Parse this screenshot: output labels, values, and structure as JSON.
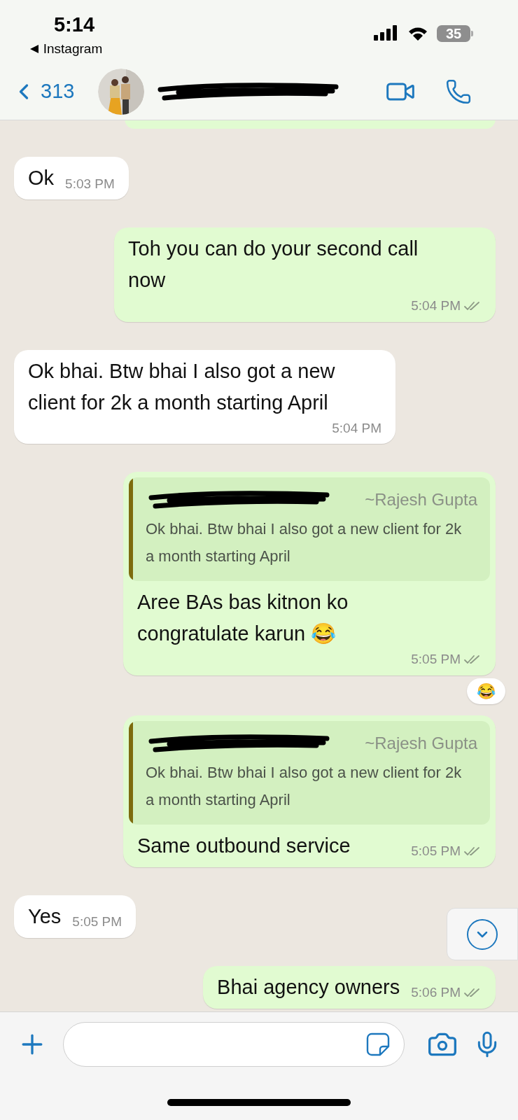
{
  "status_bar": {
    "time": "5:14",
    "back_app": "Instagram",
    "battery": "35"
  },
  "header": {
    "back_count": "313"
  },
  "messages": [
    {
      "kind": "outgoing",
      "cut": true
    },
    {
      "kind": "incoming",
      "text": "Ok",
      "time": "5:03 PM"
    },
    {
      "kind": "outgoing",
      "text": "Toh you can do your second call now",
      "time": "5:04 PM",
      "delivered": true
    },
    {
      "kind": "incoming",
      "text": "Ok bhai. Btw bhai I also got a new client for 2k a month starting April",
      "time": "5:04 PM"
    },
    {
      "kind": "outgoing",
      "quote": {
        "author": "~Rajesh Gupta",
        "text": "Ok bhai. Btw bhai I also got a new client for 2k a month starting April"
      },
      "text": "Aree BAs bas kitnon ko congratulate karun 😂",
      "time": "5:05 PM",
      "delivered": true,
      "reaction": "😂"
    },
    {
      "kind": "outgoing",
      "quote": {
        "author": "~Rajesh Gupta",
        "text": "Ok bhai. Btw bhai I also got a new client for 2k a month starting April"
      },
      "text": "Same outbound service",
      "time": "5:05 PM",
      "delivered": true
    },
    {
      "kind": "incoming",
      "text": "Yes",
      "time": "5:05 PM"
    },
    {
      "kind": "outgoing",
      "text": "Bhai agency owners",
      "time": "5:06 PM",
      "delivered": true
    }
  ]
}
